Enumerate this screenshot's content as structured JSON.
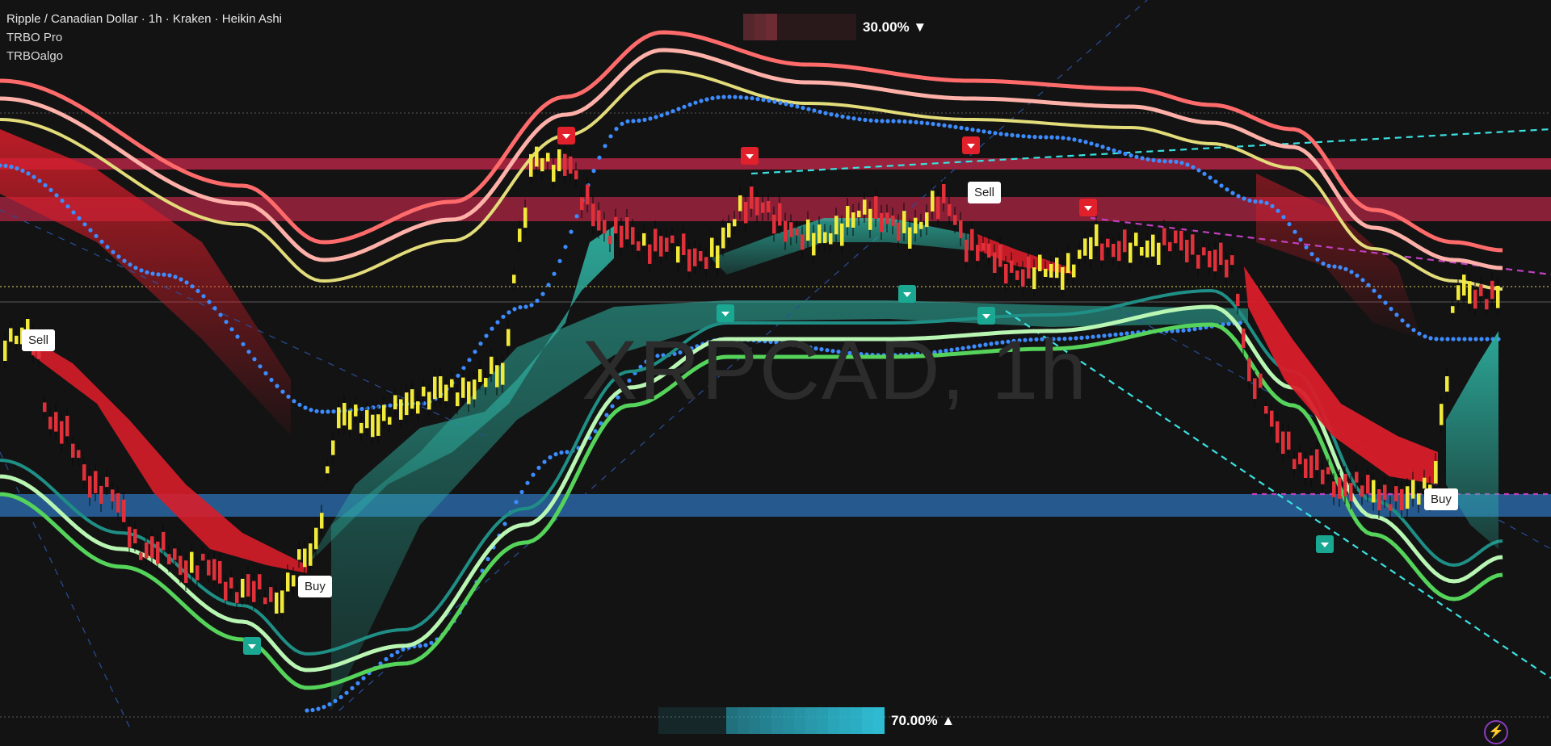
{
  "legend": {
    "symbol": "Ripple / Canadian Dollar · 1h · Kraken · Heikin Ashi",
    "indicator_1": "TRBO Pro",
    "indicator_2": "TRBOalgo"
  },
  "watermark": "XRPCAD, 1h",
  "signals": [
    {
      "label": "Sell",
      "type": "sell"
    },
    {
      "label": "Buy",
      "type": "buy"
    },
    {
      "label": "Sell",
      "type": "sell"
    },
    {
      "label": "Buy",
      "type": "buy"
    }
  ],
  "gauges": {
    "top": {
      "text": "30.00% ▼",
      "value_pct": 30
    },
    "bottom": {
      "text": "70.00% ▲",
      "value_pct": 70
    }
  },
  "colors": {
    "background": "#131313",
    "bull_candle": "#f2ea3a",
    "bear_candle": "#e0303a",
    "cloud_bull": "#2fb7a6",
    "cloud_bear": "#d81e2a",
    "band_red": "#ff6b6b",
    "band_pink": "#ffb0a8",
    "band_yellow": "#e3dc7a",
    "band_blue_dots": "#3d8cff",
    "band_green_light": "#b9f5b3",
    "band_green": "#55d35a",
    "band_teal": "#1f8f86",
    "zone_red": "#c8284b",
    "zone_blue": "#2e73b8",
    "trendline_cyan": "#3be0e0",
    "trendline_magenta": "#c040c0"
  },
  "icons": {
    "sell_marker": "down-arrow-flag-icon",
    "buy_marker": "up-arrow-flag-icon",
    "bolt": "lightning-bolt-icon"
  }
}
